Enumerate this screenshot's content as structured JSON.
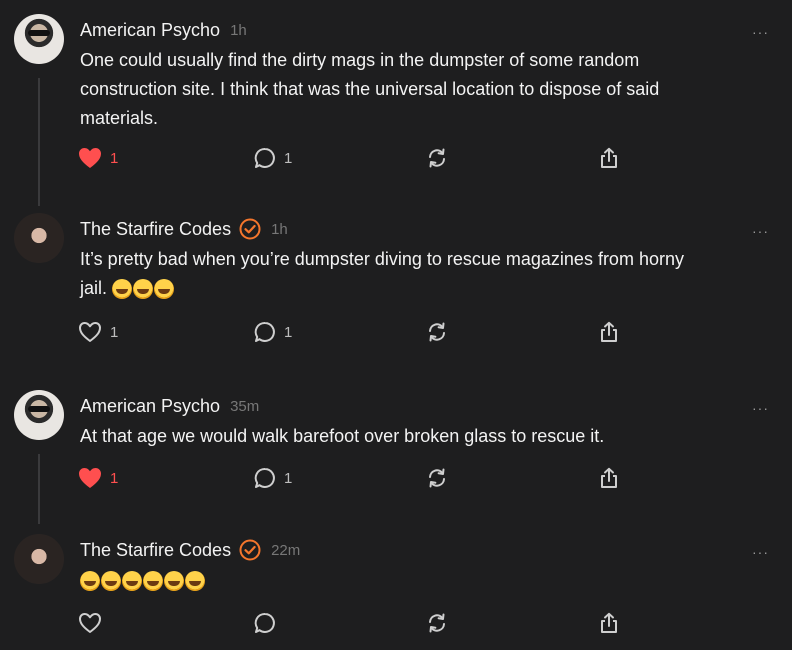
{
  "colors": {
    "background": "#1e1e1f",
    "text": "#f3f3f3",
    "muted": "#777777",
    "like_active": "#ff4f4f",
    "verified": "#f5762c",
    "thread_line": "#3a3a3c"
  },
  "more_label": "···",
  "posts": [
    {
      "username": "American Psycho",
      "time": "1h",
      "verified": false,
      "text_lines": [
        "One could usually find the dirty mags in the dumpster of some random",
        "construction site.  I think that was the universal location to dispose of said",
        "materials."
      ],
      "likes": "1",
      "liked": true,
      "replies": "1",
      "icons": [
        "heart-icon",
        "comment-icon",
        "repost-icon",
        "share-icon"
      ]
    },
    {
      "username": "The Starfire Codes",
      "time": "1h",
      "verified": true,
      "text_lines": [
        "It’s pretty bad when you’re dumpster diving to rescue magazines from horny",
        "jail. "
      ],
      "emoji_count": 3,
      "emoji_name": "rolling-on-floor-laughing-emoji",
      "likes": "1",
      "liked": false,
      "replies": "1",
      "icons": [
        "heart-outline-icon",
        "comment-icon",
        "repost-icon",
        "share-icon"
      ]
    },
    {
      "username": "American Psycho",
      "time": "35m",
      "verified": false,
      "text_lines": [
        "At that age we would walk barefoot over broken glass to rescue it."
      ],
      "likes": "1",
      "liked": true,
      "replies": "1",
      "icons": [
        "heart-icon",
        "comment-icon",
        "repost-icon",
        "share-icon"
      ]
    },
    {
      "username": "The Starfire Codes",
      "time": "22m",
      "verified": true,
      "text_lines": [],
      "emoji_count": 6,
      "emoji_name": "rolling-on-floor-laughing-emoji",
      "likes": "",
      "liked": false,
      "replies": "",
      "icons": [
        "heart-outline-icon",
        "comment-icon",
        "repost-icon",
        "share-icon"
      ]
    }
  ]
}
